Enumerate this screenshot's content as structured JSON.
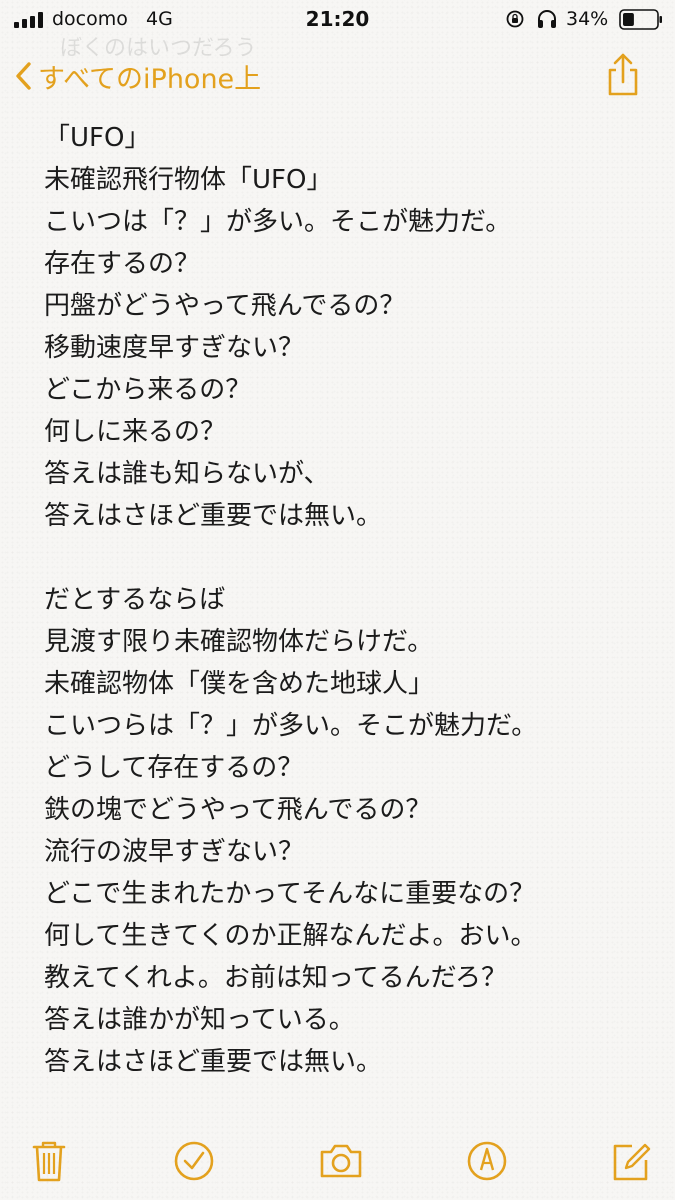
{
  "status_bar": {
    "carrier": "docomo",
    "network": "4G",
    "time": "21:20",
    "battery_percent": "34%",
    "battery_level": 0.34,
    "icons": [
      "signal-bars-icon",
      "orientation-lock-icon",
      "headphones-icon",
      "battery-icon"
    ]
  },
  "nav": {
    "faded_title": "ぼくのはいつだろう",
    "back_label": "すべてのiPhone上",
    "accent_color": "#e3a11e",
    "share_icon": "share-icon"
  },
  "note": {
    "lines": [
      "「UFO」",
      "未確認飛行物体「UFO」",
      "こいつは「？」が多い。そこが魅力だ。",
      "存在するの？",
      "円盤がどうやって飛んでるの？",
      "移動速度早すぎない？",
      "どこから来るの？",
      "何しに来るの？",
      "答えは誰も知らないが、",
      "答えはさほど重要では無い。",
      "",
      "だとするならば",
      "見渡す限り未確認物体だらけだ。",
      "未確認物体「僕を含めた地球人」",
      "こいつらは「？」が多い。そこが魅力だ。",
      "どうして存在するの？",
      "鉄の塊でどうやって飛んでるの？",
      "流行の波早すぎない？",
      "どこで生まれたかってそんなに重要なの？",
      "何して生きてくのか正解なんだよ。おい。",
      "教えてくれよ。お前は知ってるんだろ？",
      "答えは誰かが知っている。",
      "答えはさほど重要では無い。"
    ]
  },
  "toolbar": {
    "icons": [
      "trash-icon",
      "checklist-icon",
      "camera-icon",
      "markup-icon",
      "compose-icon"
    ]
  }
}
